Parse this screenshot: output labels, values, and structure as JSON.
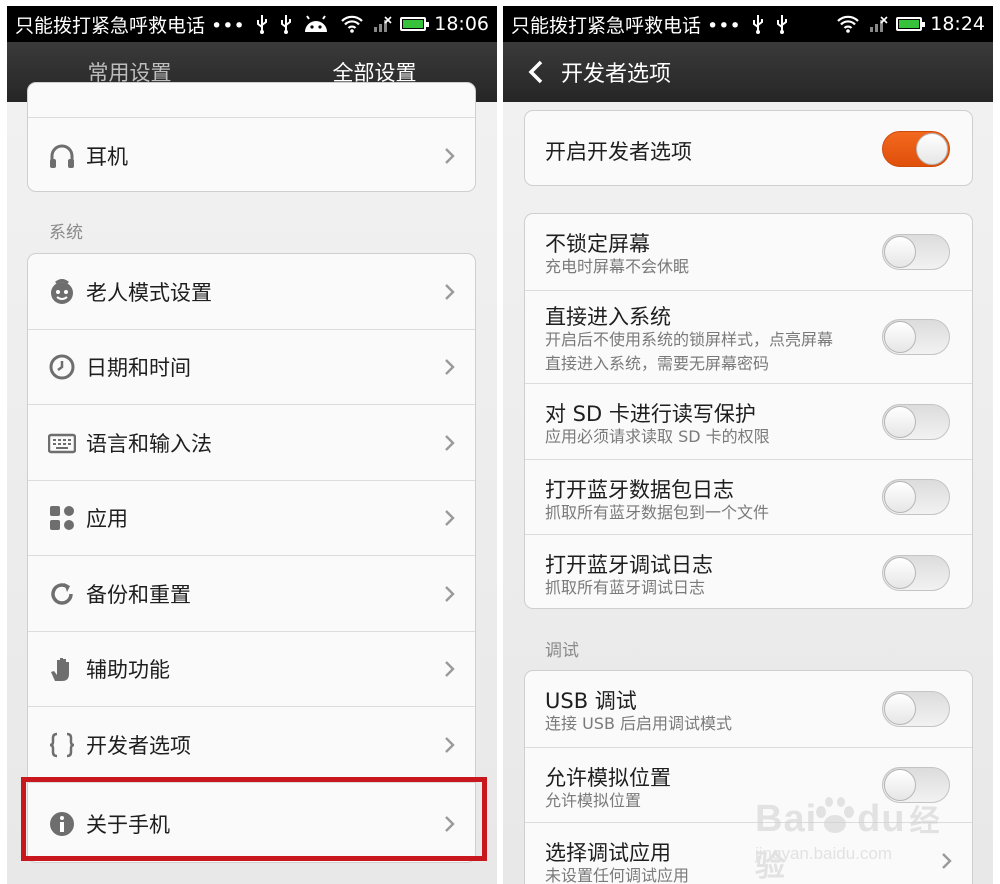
{
  "left": {
    "statusbar": {
      "carrier": "只能拨打紧急呼救电话 •••",
      "time": "18:06"
    },
    "tabs": {
      "common": "常用设置",
      "all": "全部设置"
    },
    "top_card": {
      "label": "耳机"
    },
    "section_system": "系统",
    "system_items": [
      {
        "label": "老人模式设置",
        "icon": "face-icon"
      },
      {
        "label": "日期和时间",
        "icon": "clock-icon"
      },
      {
        "label": "语言和输入法",
        "icon": "keyboard-icon"
      },
      {
        "label": "应用",
        "icon": "apps-icon"
      },
      {
        "label": "备份和重置",
        "icon": "refresh-icon"
      },
      {
        "label": "辅助功能",
        "icon": "hand-icon"
      },
      {
        "label": "开发者选项",
        "icon": "braces-icon"
      },
      {
        "label": "关于手机",
        "icon": "info-icon"
      }
    ],
    "highlight_color": "#c8171d"
  },
  "right": {
    "statusbar": {
      "carrier": "只能拨打紧急呼救电话 •••",
      "time": "18:24"
    },
    "header_title": "开发者选项",
    "master": {
      "title": "开启开发者选项",
      "on": true
    },
    "items": [
      {
        "title": "不锁定屏幕",
        "subtitle": [
          "充电时屏幕不会休眠"
        ],
        "on": false
      },
      {
        "title": "直接进入系统",
        "subtitle": [
          "开启后不使用系统的锁屏样式，点亮屏幕",
          "直接进入系统，需要无屏幕密码"
        ],
        "on": false
      },
      {
        "title": "对 SD 卡进行读写保护",
        "subtitle": [
          "应用必须请求读取 SD 卡的权限"
        ],
        "on": false
      },
      {
        "title": "打开蓝牙数据包日志",
        "subtitle": [
          "抓取所有蓝牙数据包到一个文件"
        ],
        "on": false
      },
      {
        "title": "打开蓝牙调试日志",
        "subtitle": [
          "抓取所有蓝牙调试日志"
        ],
        "on": false
      }
    ],
    "section_debug": "调试",
    "debug_items": [
      {
        "title": "USB 调试",
        "subtitle": "连接 USB 后启用调试模式",
        "on": false
      },
      {
        "title": "允许模拟位置",
        "subtitle": "允许模拟位置",
        "on": false
      },
      {
        "title": "选择调试应用",
        "subtitle": "未设置任何调试应用"
      }
    ],
    "toggle_on_color": "#f2681e"
  },
  "watermark": {
    "logo": "Bai",
    "logo2": "du",
    "cn": "经验",
    "url": "jingyan.baidu.com"
  }
}
